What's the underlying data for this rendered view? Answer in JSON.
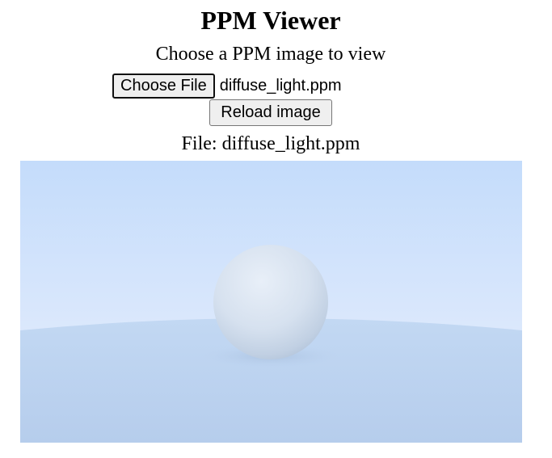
{
  "page": {
    "title": "PPM Viewer",
    "subtitle": "Choose a PPM image to view"
  },
  "file_input": {
    "button_label": "Choose File",
    "selected_file": "diffuse_light.ppm"
  },
  "reload": {
    "label": "Reload image"
  },
  "file_label": {
    "prefix": "File:",
    "name": "diffuse_light.ppm"
  },
  "image": {
    "description_colors": {
      "sky_top": "#c4dcfb",
      "sky_horizon": "#e7f0fd",
      "ground": "#b8d0ee",
      "sphere_light": "#e6edf7",
      "sphere_dark": "#b6c7dc"
    }
  }
}
